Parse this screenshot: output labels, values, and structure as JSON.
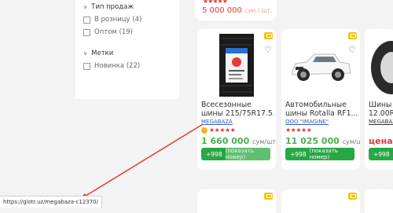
{
  "filters": {
    "sale_type": {
      "title": "Тип продаж",
      "options": [
        {
          "label": "В розницу (4)"
        },
        {
          "label": "Оптом (19)"
        }
      ]
    },
    "tags": {
      "title": "Метки",
      "options": [
        {
          "label": "Новинка (22)"
        }
      ]
    }
  },
  "top_card": {
    "stars": "★★★★★",
    "price": "5 000 000",
    "unit": "сум / шт."
  },
  "cards": [
    {
      "title_line1": "Всесезонные",
      "title_line2": "шины 215/75R17.5...",
      "seller": "MEGABAZA",
      "stars": "★★★★★",
      "price": "1 660 000",
      "unit": "сум/шт.",
      "phone_code": "+998",
      "phone_action": "(показать номер)"
    },
    {
      "title_line1": "Автомобильные",
      "title_line2": "шины Rotalla RF1...",
      "seller": "ООО \"IMAGINE\"",
      "stars": "★★★★★",
      "price": "11 025 000",
      "unit": "сум/шт.",
      "phone_code": "+998",
      "phone_action": "(показать номер)"
    },
    {
      "title_line1": "Шины",
      "title_line2": "12.00R2",
      "seller": "MEGABAZ",
      "stars": "",
      "price": "цена д",
      "unit": "",
      "phone_code": "+998",
      "phone_action": ""
    }
  ],
  "status_bar": {
    "url": "https://glotr.uz/megabaza-c12370/"
  },
  "colors": {
    "accent_red": "#e53935",
    "price_green": "#4caf50",
    "phone_green": "#28a745",
    "badge_yellow": "#f4c20d",
    "link_blue": "#2d5fc4"
  }
}
